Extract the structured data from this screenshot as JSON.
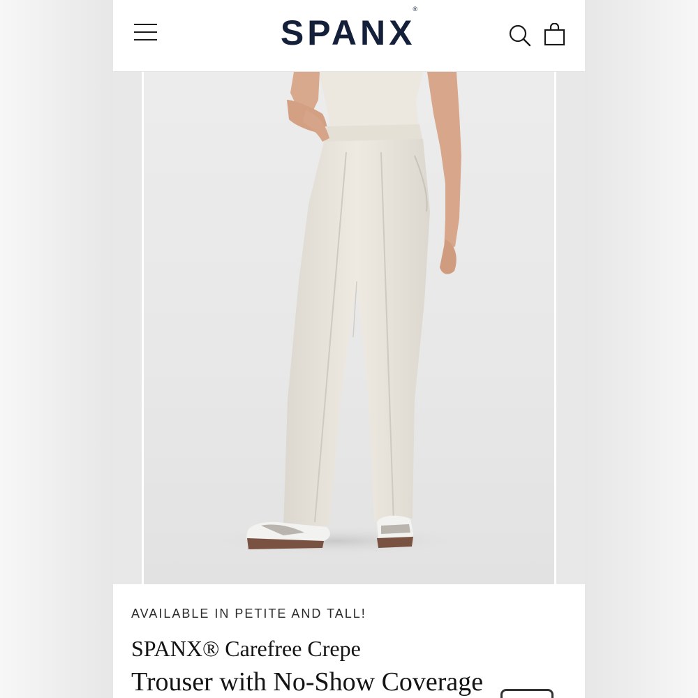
{
  "header": {
    "brand": "SPANX",
    "brand_mark": "®",
    "menu_icon": "hamburger-menu-icon",
    "search_icon": "search-icon",
    "cart_icon": "shopping-bag-icon"
  },
  "gallery": {
    "image_subject": "model wearing cream wide-leg trousers and white sneakers"
  },
  "product": {
    "availability_label": "AVAILABLE IN PETITE AND TALL!",
    "title_line1": "SPANX® Carefree Crepe",
    "title_line2": "Trouser with No-Show Coverage"
  },
  "colors": {
    "brand_navy": "#14203a",
    "trouser_cream": "#e9e5dc"
  }
}
